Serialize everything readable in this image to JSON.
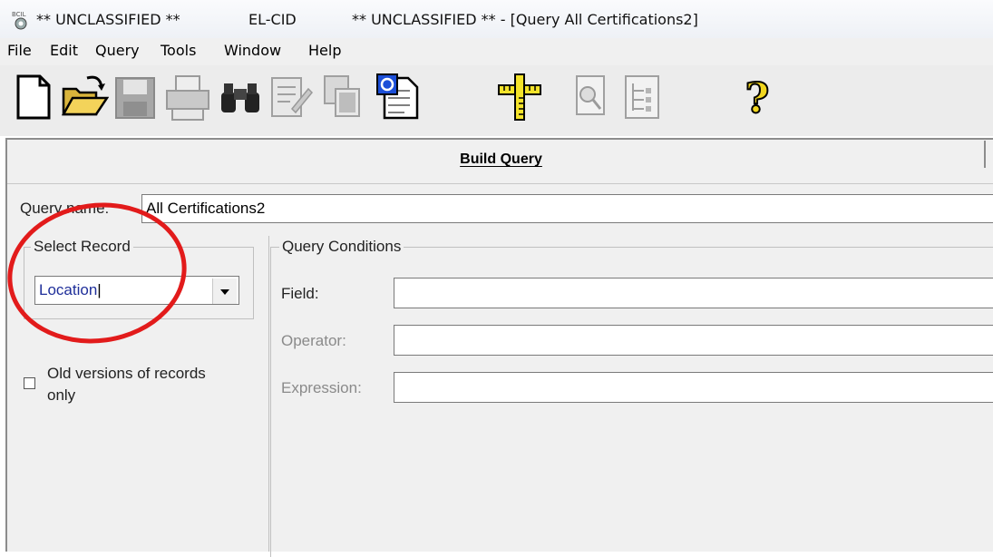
{
  "titlebar": {
    "classification_left": "** UNCLASSIFIED **",
    "app_name": "EL-CID",
    "window_title": "** UNCLASSIFIED ** - [Query All Certifications2]",
    "app_icon": "elcid-app-icon"
  },
  "menu": {
    "items": [
      {
        "label": "File"
      },
      {
        "label": "Edit"
      },
      {
        "label": "Query"
      },
      {
        "label": "Tools"
      },
      {
        "label": "Window"
      },
      {
        "label": "Help"
      }
    ]
  },
  "toolbar": {
    "buttons": [
      {
        "icon": "new-document-icon",
        "enabled": true
      },
      {
        "icon": "open-folder-icon",
        "enabled": true
      },
      {
        "icon": "save-icon",
        "enabled": false
      },
      {
        "icon": "print-icon",
        "enabled": false
      },
      {
        "icon": "binoculars-find-icon",
        "enabled": true
      },
      {
        "icon": "edit-records-icon",
        "enabled": false
      },
      {
        "icon": "copy-records-icon",
        "enabled": false
      },
      {
        "icon": "export-document-icon",
        "enabled": true
      },
      {
        "icon": "measure-ruler-icon",
        "enabled": true
      },
      {
        "icon": "preview-magnify-icon",
        "enabled": false
      },
      {
        "icon": "tree-view-icon",
        "enabled": false
      },
      {
        "icon": "help-question-icon",
        "enabled": true
      }
    ]
  },
  "build_query": {
    "title": "Build Query",
    "query_name_label": "Query name:",
    "query_name_value": "All Certifications2",
    "select_record": {
      "legend": "Select Record",
      "selected": "Location"
    },
    "old_versions": {
      "label_line1": "Old versions of records",
      "label_line2": "only",
      "checked": false
    },
    "conditions": {
      "legend": "Query Conditions",
      "field_label": "Field:",
      "field_value": "",
      "operator_label": "Operator:",
      "operator_value": "",
      "expression_label": "Expression:",
      "expression_value": ""
    }
  },
  "annotation_color": "#e21b1b"
}
